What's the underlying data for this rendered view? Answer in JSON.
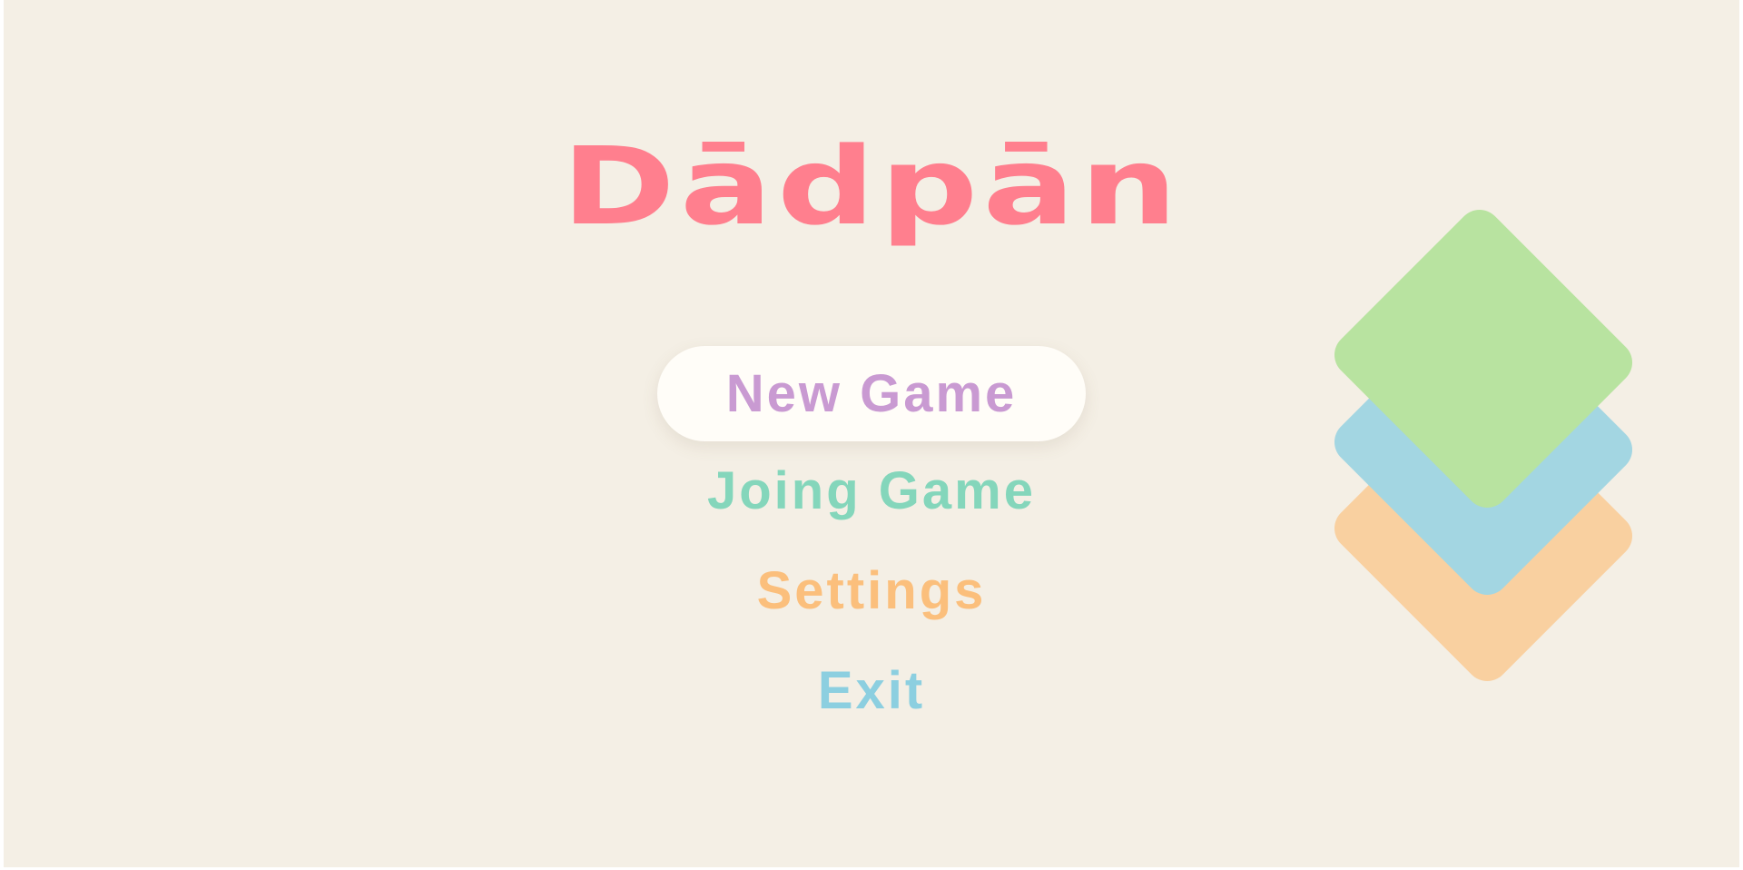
{
  "logo": {
    "text": "Dādpān",
    "color": "#ff7f8e"
  },
  "menu": {
    "items": [
      {
        "label": "New Game",
        "color": "#c99ad2",
        "selected": true
      },
      {
        "label": "Joing Game",
        "color": "#84d6bb",
        "selected": false
      },
      {
        "label": "Settings",
        "color": "#fbbf7c",
        "selected": false
      },
      {
        "label": "Exit",
        "color": "#8ccfe0",
        "selected": false
      }
    ]
  },
  "cards": {
    "colors": {
      "back": "#f9d0a0",
      "middle": "#a3d6e2",
      "front": "#b8e3a0"
    }
  },
  "background": "#f4efe5"
}
